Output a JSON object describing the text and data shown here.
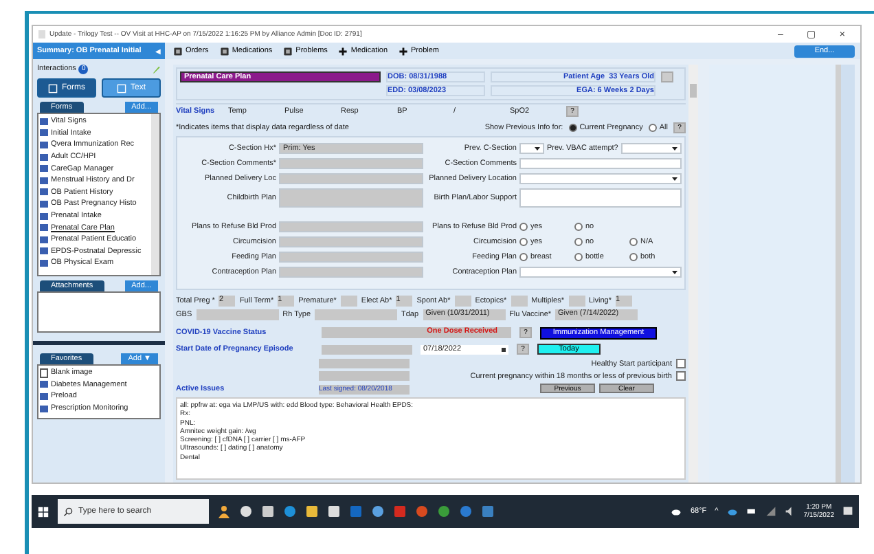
{
  "window": {
    "title": "Update - Trilogy Test -- OV Visit at HHC-AP on 7/15/2022 1:16:25 PM by Alliance Admin [Doc ID: 2791]",
    "controls": [
      "–",
      "▢",
      "×"
    ]
  },
  "sidebar": {
    "summary": "Summary: OB Prenatal Initial",
    "collapse": "◀",
    "interactions": "Interactions",
    "interactions_badge": "0",
    "view_buttons": [
      {
        "label": "Forms",
        "selected": true
      },
      {
        "label": "Text",
        "selected": false
      }
    ],
    "forms": {
      "tab": "Forms",
      "add": "Add...",
      "items": [
        {
          "label": "Vital Signs",
          "selected": false
        },
        {
          "label": "Initial Intake",
          "selected": false
        },
        {
          "label": "Qvera Immunization Rec",
          "selected": false
        },
        {
          "label": "Adult CC/HPI",
          "selected": false
        },
        {
          "label": "CareGap Manager",
          "selected": false
        },
        {
          "label": "Menstrual History and Dr",
          "selected": false
        },
        {
          "label": "OB Patient History",
          "selected": false
        },
        {
          "label": "OB Past Pregnancy Histo",
          "selected": false
        },
        {
          "label": "Prenatal Intake",
          "selected": false
        },
        {
          "label": "Prenatal Care Plan",
          "selected": true
        },
        {
          "label": "Prenatal Patient Educatio",
          "selected": false
        },
        {
          "label": "EPDS-Postnatal Depressic",
          "selected": false
        },
        {
          "label": "OB Physical Exam",
          "selected": false
        }
      ]
    },
    "attachments": {
      "tab": "Attachments",
      "add": "Add..."
    },
    "favorites": {
      "tab": "Favorites",
      "add": "Add ▼",
      "items": [
        {
          "label": "Blank image",
          "kind": "document"
        },
        {
          "label": "Diabetes Management",
          "kind": "form"
        },
        {
          "label": "Preload",
          "kind": "form"
        },
        {
          "label": "Prescription Monitoring",
          "kind": "form"
        }
      ]
    }
  },
  "toolbar": {
    "items": [
      {
        "label": "Orders",
        "kind": "orders"
      },
      {
        "label": "Medications",
        "kind": "medications"
      },
      {
        "label": "Problems",
        "kind": "problems"
      },
      {
        "label": "Medication",
        "kind": "add"
      },
      {
        "label": "Problem",
        "kind": "add"
      }
    ],
    "end_button": "End..."
  },
  "form": {
    "title": "Prenatal Care Plan",
    "dob": "DOB: 08/31/1988",
    "edd": "EDD: 03/08/2023",
    "age_label": "Patient Age",
    "age": "33 Years Old",
    "ega": "EGA: 6 Weeks 2 Days",
    "vitals": {
      "title": "Vital Signs",
      "items": [
        "Temp",
        "Pulse",
        "Resp",
        "BP",
        "/",
        "SpO2"
      ],
      "help": "?"
    },
    "note": "*Indicates items that display data regardless of date",
    "show_label": "Show Previous Info for:",
    "show_options": [
      {
        "label": "Current Pregnancy",
        "selected": true
      },
      {
        "label": "All",
        "selected": false
      }
    ],
    "note_button": "?",
    "left_fields": [
      {
        "label": "C-Section Hx*",
        "value": "Prim: Yes",
        "kind": "text"
      },
      {
        "label": "C-Section Comments*",
        "kind": "text"
      },
      {
        "label": "Planned Delivery Loc",
        "kind": "text"
      },
      {
        "label": "Childbirth Plan",
        "kind": "area"
      },
      {
        "label": "Plans to Refuse Bld Prod",
        "kind": "text"
      },
      {
        "label": "Circumcision",
        "kind": "text"
      },
      {
        "label": "Feeding Plan",
        "kind": "text"
      },
      {
        "label": "Contraception Plan",
        "kind": "text"
      }
    ],
    "right_fields": [
      {
        "kind": "pair",
        "label": "Prev. C-Section",
        "label2": "Prev. VBAC attempt?"
      },
      {
        "kind": "text",
        "label": "C-Section Comments"
      },
      {
        "kind": "dropdown",
        "label": "Planned Delivery Location"
      },
      {
        "kind": "area",
        "label": "Birth Plan/Labor Support"
      },
      {
        "kind": "radio",
        "label": "Plans to Refuse Bld Prod",
        "options": [
          {
            "label": "yes",
            "selected": false
          },
          {
            "label": "no",
            "selected": false
          }
        ]
      },
      {
        "kind": "radio",
        "label": "Circumcision",
        "options": [
          {
            "label": "yes",
            "selected": false
          },
          {
            "label": "no",
            "selected": false
          },
          {
            "label": "N/A",
            "selected": false
          }
        ]
      },
      {
        "kind": "radio",
        "label": "Feeding Plan",
        "options": [
          {
            "label": "breast",
            "selected": false
          },
          {
            "label": "bottle",
            "selected": false
          },
          {
            "label": "both",
            "selected": false
          }
        ]
      },
      {
        "kind": "dropdown",
        "label": "Contraception Plan"
      }
    ],
    "history": [
      {
        "label": "Total Preg *",
        "value": "2"
      },
      {
        "label": "Full Term*",
        "value": "1"
      },
      {
        "label": "Premature*"
      },
      {
        "label": "Elect Ab*",
        "value": "1"
      },
      {
        "label": "Spont Ab*"
      },
      {
        "label": "Ectopics*"
      },
      {
        "label": "Multiples*"
      },
      {
        "label": "Living*",
        "value": "1"
      }
    ],
    "history2": [
      {
        "label": "GBS",
        "kind": "wide"
      },
      {
        "label": "Rh Type",
        "kind": "wide"
      },
      {
        "label": "Tdap",
        "value": "Given (10/31/2011)",
        "kind": "mid"
      },
      {
        "label": "Flu Vaccine*",
        "value": "Given (7/14/2022)",
        "kind": "mid"
      }
    ],
    "covid": {
      "label": "COVID-19 Vaccine Status",
      "value": "One Dose Received",
      "help": "?",
      "button": "Immunization Management"
    },
    "start": {
      "label": "Start Date of Pregnancy Episode",
      "value": "07/18/2022",
      "help": "?",
      "button": "Today"
    },
    "checks": [
      {
        "label": "Healthy Start participant",
        "checked": false
      },
      {
        "label": "Current pregnancy within 18 months or less of previous birth",
        "checked": false
      }
    ],
    "buttons": [
      "Previous",
      "Clear"
    ],
    "issues_label": "Active Issues",
    "last_signed": "Last signed: 08/20/2018",
    "notes": [
      "all: ppfrw at: ega via LMP/US with: edd Blood type: Behavioral Health EPDS:",
      "Rx:",
      "PNL:",
      "Amnitec weight gain: /wg",
      "Screening: [ ] cfDNA [ ] carrier [ ] ms-AFP",
      "Ultrasounds: [ ] dating [ ] anatomy",
      "Dental"
    ]
  },
  "taskbar": {
    "search_placeholder": "Type here to search",
    "weather": "68°F",
    "tray": "^",
    "time": "1:20 PM",
    "date": "7/15/2022"
  }
}
